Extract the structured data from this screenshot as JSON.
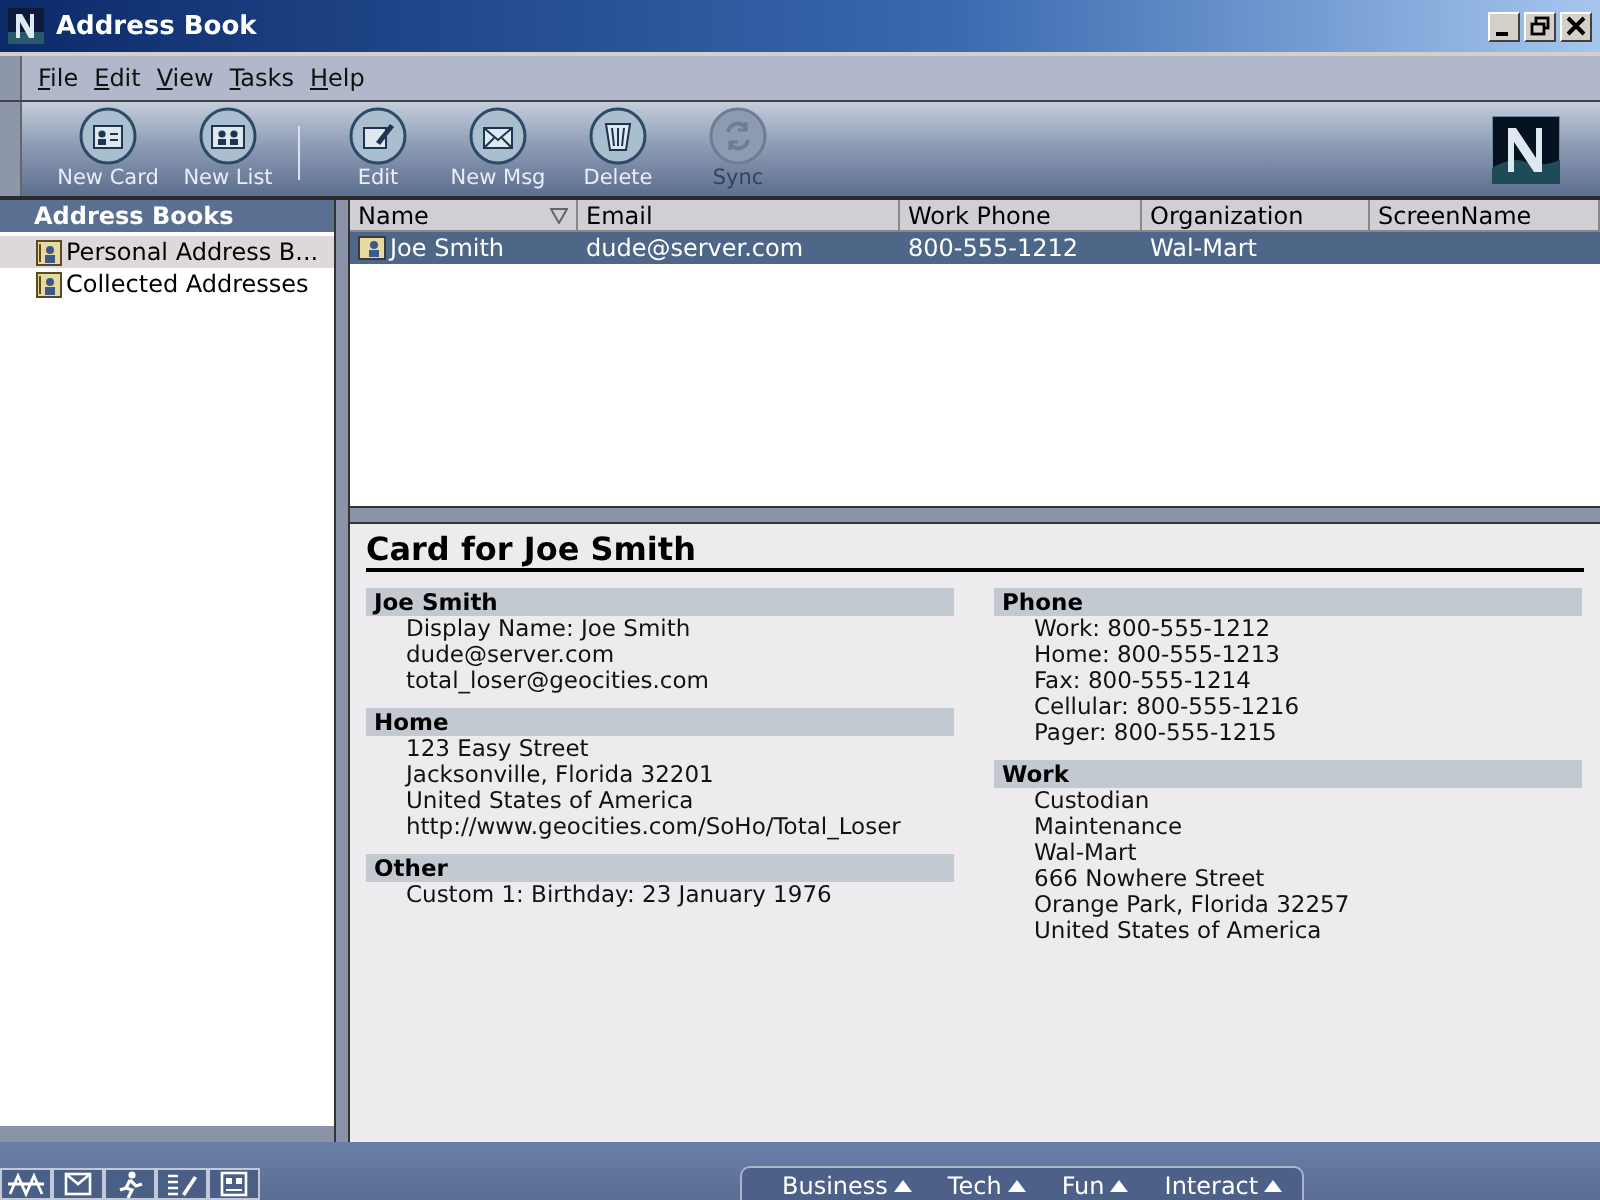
{
  "window": {
    "title": "Address Book"
  },
  "menu": [
    "File",
    "Edit",
    "View",
    "Tasks",
    "Help"
  ],
  "toolbar": [
    {
      "label": "New Card",
      "kind": "card",
      "disabled": false
    },
    {
      "label": "New List",
      "kind": "list",
      "disabled": false
    },
    {
      "label": "Edit",
      "kind": "edit",
      "disabled": false
    },
    {
      "label": "New Msg",
      "kind": "msg",
      "disabled": false
    },
    {
      "label": "Delete",
      "kind": "delete",
      "disabled": false
    },
    {
      "label": "Sync",
      "kind": "sync",
      "disabled": true
    }
  ],
  "sidebar": {
    "title": "Address Books",
    "items": [
      {
        "label": "Personal Address B...",
        "selected": true
      },
      {
        "label": "Collected Addresses",
        "selected": false
      }
    ]
  },
  "table": {
    "columns": [
      {
        "label": "Name",
        "sorted": true
      },
      {
        "label": "Email",
        "sorted": false
      },
      {
        "label": "Work Phone",
        "sorted": false
      },
      {
        "label": "Organization",
        "sorted": false
      },
      {
        "label": "ScreenName",
        "sorted": false
      }
    ],
    "rows": [
      {
        "cells": [
          "Joe Smith",
          "dude@server.com",
          "800-555-1212",
          "Wal-Mart"
        ],
        "selected": true
      }
    ]
  },
  "card": {
    "title": "Card for Joe Smith",
    "left": [
      {
        "heading": "Joe Smith",
        "lines": [
          "Display Name: Joe Smith",
          "dude@server.com",
          "total_loser@geocities.com"
        ]
      },
      {
        "heading": "Home",
        "lines": [
          "123 Easy Street",
          "Jacksonville, Florida 32201",
          "United States of America",
          "http://www.geocities.com/SoHo/Total_Loser"
        ]
      },
      {
        "heading": "Other",
        "lines": [
          "Custom 1: Birthday: 23 January 1976"
        ]
      }
    ],
    "right": [
      {
        "heading": "Phone",
        "lines": [
          "Work: 800-555-1212",
          "Home: 800-555-1213",
          "Fax: 800-555-1214",
          "Cellular: 800-555-1216",
          "Pager: 800-555-1215"
        ]
      },
      {
        "heading": "Work",
        "lines": [
          "Custodian",
          "Maintenance",
          "Wal-Mart",
          "666 Nowhere Street",
          "Orange Park, Florida 32257",
          "United States of America"
        ]
      }
    ]
  },
  "status_bar": {
    "components": [
      {
        "kind": "navigator"
      },
      {
        "kind": "mail"
      },
      {
        "kind": "runner"
      },
      {
        "kind": "composer"
      },
      {
        "kind": "addressbook"
      }
    ],
    "tabs": [
      "Business",
      "Tech",
      "Fun",
      "Interact"
    ]
  }
}
